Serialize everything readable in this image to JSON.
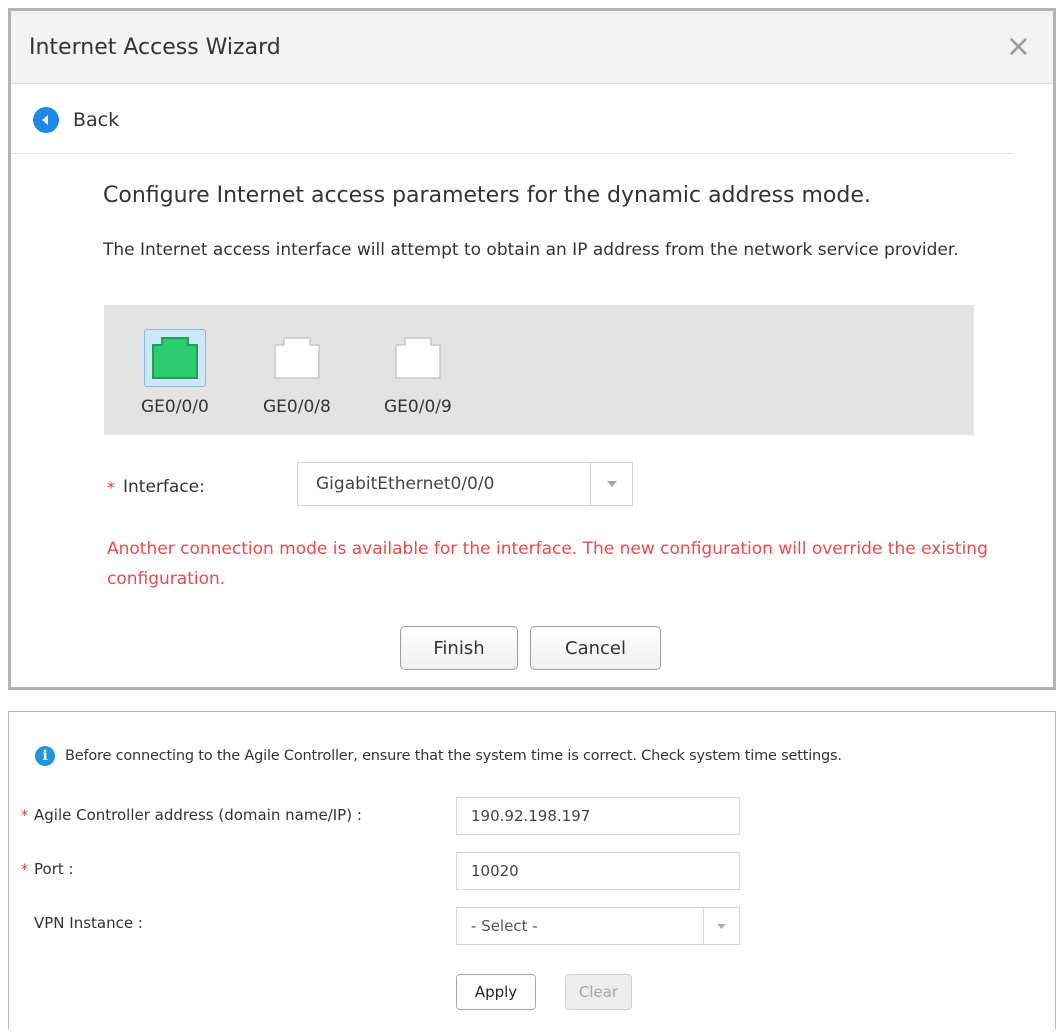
{
  "wizard": {
    "title": "Internet Access Wizard",
    "close_symbol": "×",
    "back_label": "Back",
    "heading": "Configure Internet access parameters for the dynamic address mode.",
    "description": "The Internet access interface will attempt to obtain an IP address from the network service provider.",
    "ports": [
      {
        "label": "GE0/0/0",
        "selected": true
      },
      {
        "label": "GE0/0/8",
        "selected": false
      },
      {
        "label": "GE0/0/9",
        "selected": false
      }
    ],
    "interface_label": "Interface:",
    "interface_value": "GigabitEthernet0/0/0",
    "warning": "Another connection mode is available for the interface. The new configuration will override the existing configuration.",
    "finish_label": "Finish",
    "cancel_label": "Cancel"
  },
  "agile": {
    "info": "Before connecting to the Agile Controller, ensure that the system time is correct. Check system time settings.",
    "address_label": "Agile Controller address (domain name/IP) :",
    "address_value": "190.92.198.197",
    "port_label": "Port :",
    "port_value": "10020",
    "vpn_label": "VPN Instance :",
    "vpn_value": "- Select -",
    "apply_label": "Apply",
    "clear_label": "Clear"
  },
  "icons": {
    "back": "back-circle-icon",
    "close": "close-icon",
    "info": "info-icon",
    "dropdown": "chevron-down-icon",
    "port": "ethernet-port-icon"
  },
  "colors": {
    "port_active": "#2ecc71",
    "warning": "#ec4b4b",
    "accent": "#1e88e5",
    "required": "#e53935"
  }
}
